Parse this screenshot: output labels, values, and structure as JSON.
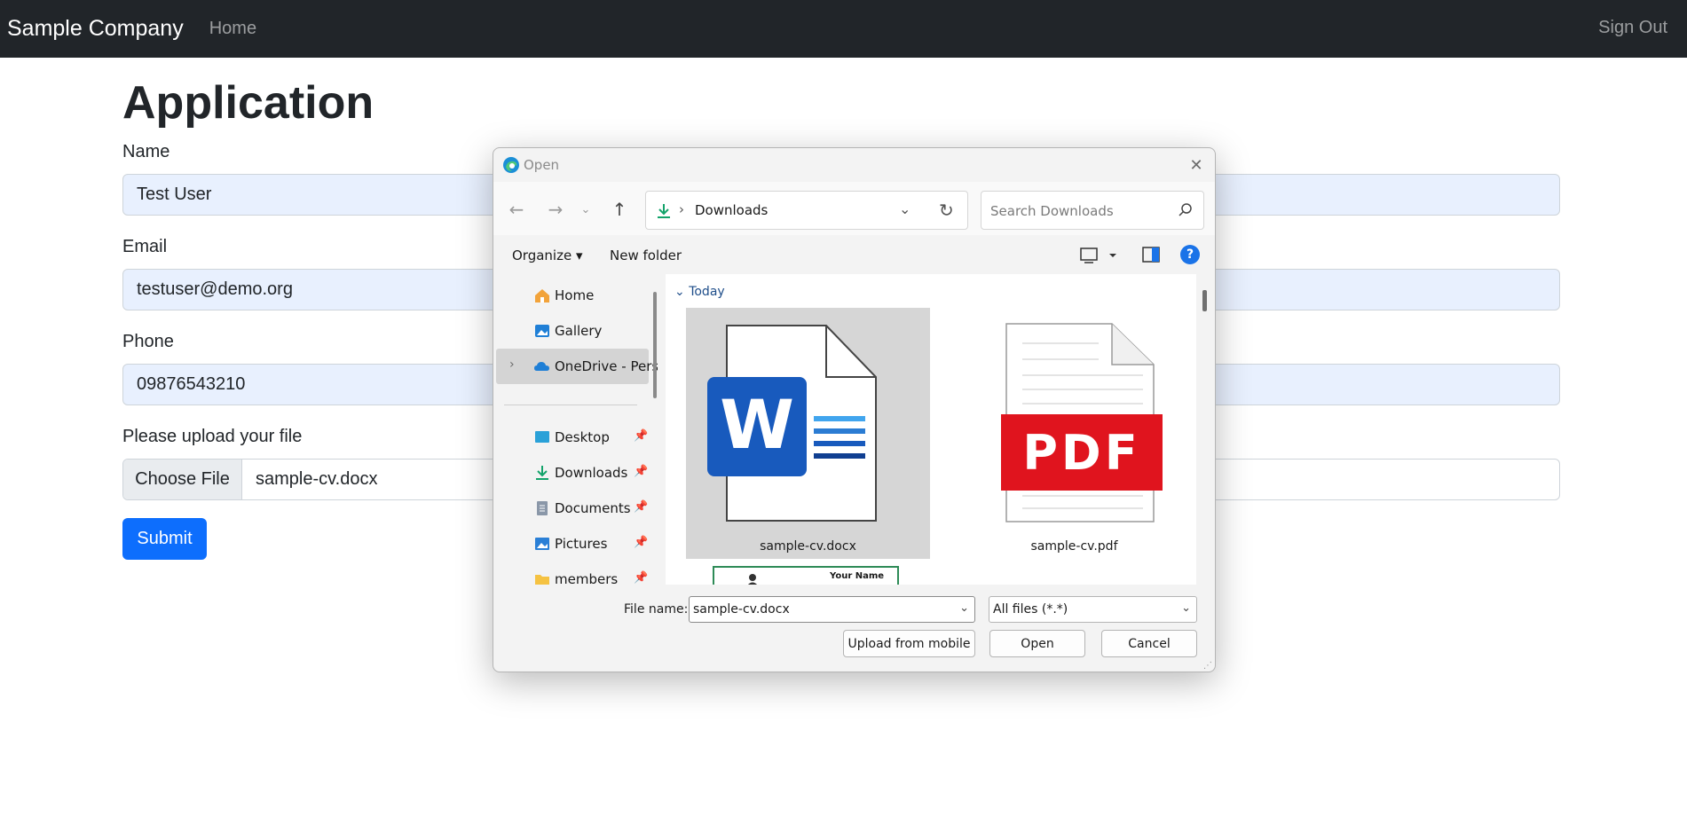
{
  "navbar": {
    "brand": "Sample Company",
    "home": "Home",
    "signout": "Sign Out"
  },
  "form": {
    "title": "Application",
    "name_label": "Name",
    "name_value": "Test User",
    "email_label": "Email",
    "email_value": "testuser@demo.org",
    "phone_label": "Phone",
    "phone_value": "09876543210",
    "file_label": "Please upload your file",
    "choose_file": "Choose File",
    "file_value": "sample-cv.docx",
    "submit": "Submit",
    "accent": "#0d6efd"
  },
  "dialog": {
    "title": "Open",
    "close": "✕",
    "address": {
      "path_sep": "›",
      "location": "Downloads"
    },
    "search_placeholder": "Search Downloads",
    "organize": "Organize ▾",
    "new_folder": "New folder",
    "help": "?",
    "nav": {
      "home": "Home",
      "gallery": "Gallery",
      "onedrive": "OneDrive - Perso",
      "desktop": "Desktop",
      "downloads": "Downloads",
      "documents": "Documents",
      "pictures": "Pictures",
      "members": "members"
    },
    "group": "Today",
    "files": [
      "sample-cv.docx",
      "sample-cv.pdf"
    ],
    "thumb3_text": "Your Name",
    "pdf_badge": "PDF",
    "word_badge": "W",
    "filename_label": "File name:",
    "filename_value": "sample-cv.docx",
    "filetype_value": "All files (*.*)",
    "upload_mobile": "Upload from mobile",
    "open": "Open",
    "cancel": "Cancel"
  }
}
